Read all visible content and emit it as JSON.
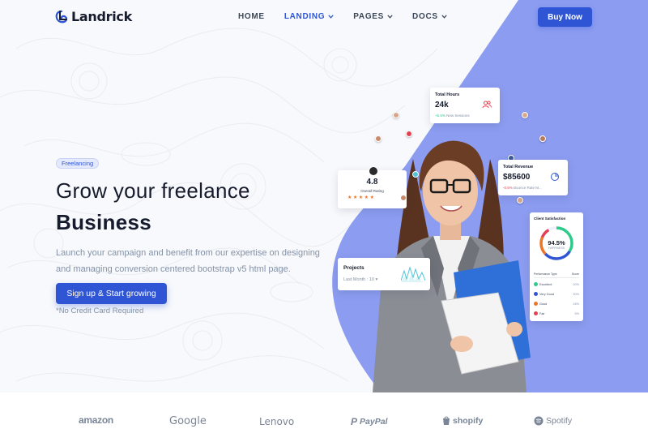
{
  "brand": {
    "name": "Landrick"
  },
  "nav": {
    "items": [
      {
        "label": "HOME",
        "has_dropdown": false,
        "active": false
      },
      {
        "label": "LANDING",
        "has_dropdown": true,
        "active": true
      },
      {
        "label": "PAGES",
        "has_dropdown": true,
        "active": false
      },
      {
        "label": "DOCS",
        "has_dropdown": true,
        "active": false
      }
    ],
    "buy_label": "Buy Now"
  },
  "hero": {
    "badge": "Freelancing",
    "title_line1": "Grow your freelance",
    "title_line2": "Business",
    "lead": "Launch your campaign and benefit from our expertise on designing and managing conversion centered bootstrap v5 html page.",
    "cta": "Sign up & Start growing",
    "note": "*No Credit Card Required"
  },
  "cards": {
    "hours": {
      "title": "Total Hours",
      "value": "24k",
      "delta": "+5.5%",
      "delta_text": "New Sessions"
    },
    "revenue": {
      "title": "Total Revenue",
      "value": "$85600",
      "delta": "-0.5%",
      "delta_text": "Bounce Rate M..."
    },
    "rating": {
      "value": "4.8",
      "label": "Overall Rating",
      "stars": 5
    },
    "projects": {
      "title": "Projects",
      "period": "Last Month : 10"
    },
    "satisfaction": {
      "title": "Client Satisfaction",
      "percent": "94.5%",
      "percent_label": "HAPPINESS",
      "table_headers": [
        "Performance Type",
        "Score"
      ],
      "rows": [
        {
          "label": "Excellent",
          "score": "20%",
          "color": "#2eca8b"
        },
        {
          "label": "Very Good",
          "score": "30%",
          "color": "#2f55d4"
        },
        {
          "label": "Good",
          "score": "15%",
          "color": "#f17425"
        },
        {
          "label": "Fair",
          "score": "5%",
          "color": "#e43f52"
        }
      ]
    }
  },
  "partners": [
    "amazon",
    "Google",
    "Lenovo",
    "PayPal",
    "shopify",
    "Spotify"
  ],
  "colors": {
    "primary": "#2f55d4",
    "purple": "#8c9cf0",
    "text": "#161c2d",
    "muted": "#8492a6"
  }
}
